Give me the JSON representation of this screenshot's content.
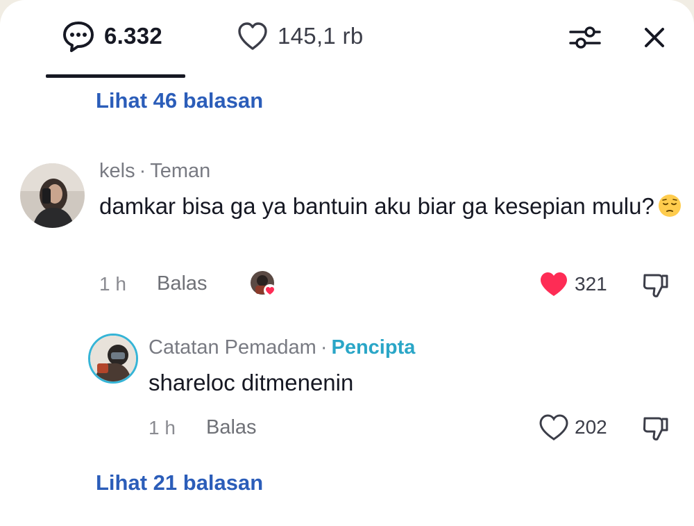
{
  "tabs": {
    "comments_count": "6.332",
    "likes_count": "145,1 rb"
  },
  "view_replies_top": "Lihat 46 balasan",
  "comment": {
    "author": "kels",
    "separator": "·",
    "relation": "Teman",
    "text": "damkar bisa ga ya bantuin aku biar ga kesepian mulu?",
    "emoji": "pensive-face",
    "time": "1 h",
    "reply_label": "Balas",
    "like_count": "321",
    "liked": true
  },
  "reply": {
    "author": "Catatan Pemadam",
    "separator": "·",
    "badge": "Pencipta",
    "text": "shareloc ditmenenin",
    "time": "1 h",
    "reply_label": "Balas",
    "like_count": "202",
    "liked": false
  },
  "view_replies_bottom": "Lihat 21 balasan",
  "colors": {
    "link_blue": "#2b5db9",
    "creator_teal": "#2aa6c7",
    "like_red": "#fe2c55",
    "text_dark": "#161823"
  }
}
